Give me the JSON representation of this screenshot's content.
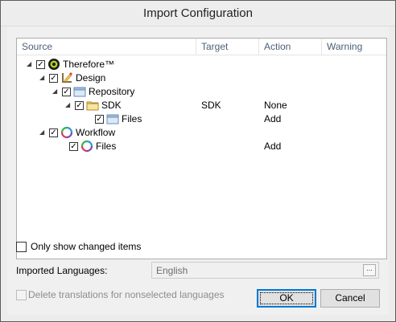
{
  "window": {
    "title": "Import Configuration"
  },
  "tree": {
    "columns": {
      "source": "Source",
      "target": "Target",
      "action": "Action",
      "warning": "Warning"
    },
    "rows": [
      {
        "label": "Therefore™",
        "target": "",
        "action": "",
        "icon": "therefore-logo-icon",
        "expanded": true,
        "checked": true
      },
      {
        "label": "Design",
        "target": "",
        "action": "",
        "icon": "design-icon",
        "expanded": true,
        "checked": true
      },
      {
        "label": "Repository",
        "target": "",
        "action": "",
        "icon": "repository-folder-icon",
        "expanded": true,
        "checked": true
      },
      {
        "label": "SDK",
        "target": "SDK",
        "action": "None",
        "icon": "folder-icon",
        "expanded": true,
        "checked": true
      },
      {
        "label": "Files",
        "target": "",
        "action": "Add",
        "icon": "files-icon",
        "expanded": false,
        "checked": true
      },
      {
        "label": "Workflow",
        "target": "",
        "action": "",
        "icon": "workflow-icon",
        "expanded": true,
        "checked": true
      },
      {
        "label": "Files",
        "target": "",
        "action": "Add",
        "icon": "workflow-files-icon",
        "expanded": false,
        "checked": true
      }
    ]
  },
  "only_changed": {
    "label": "Only show changed items",
    "checked": false
  },
  "languages": {
    "label": "Imported Languages:",
    "value": "English",
    "browse": "..."
  },
  "delete_translations": {
    "label": "Delete translations for nonselected languages",
    "checked": false,
    "enabled": false
  },
  "buttons": {
    "ok": "OK",
    "cancel": "Cancel"
  },
  "colors": {
    "accent": "#0078d7",
    "folder": "#f5d67a",
    "header_text": "#4c607a"
  }
}
